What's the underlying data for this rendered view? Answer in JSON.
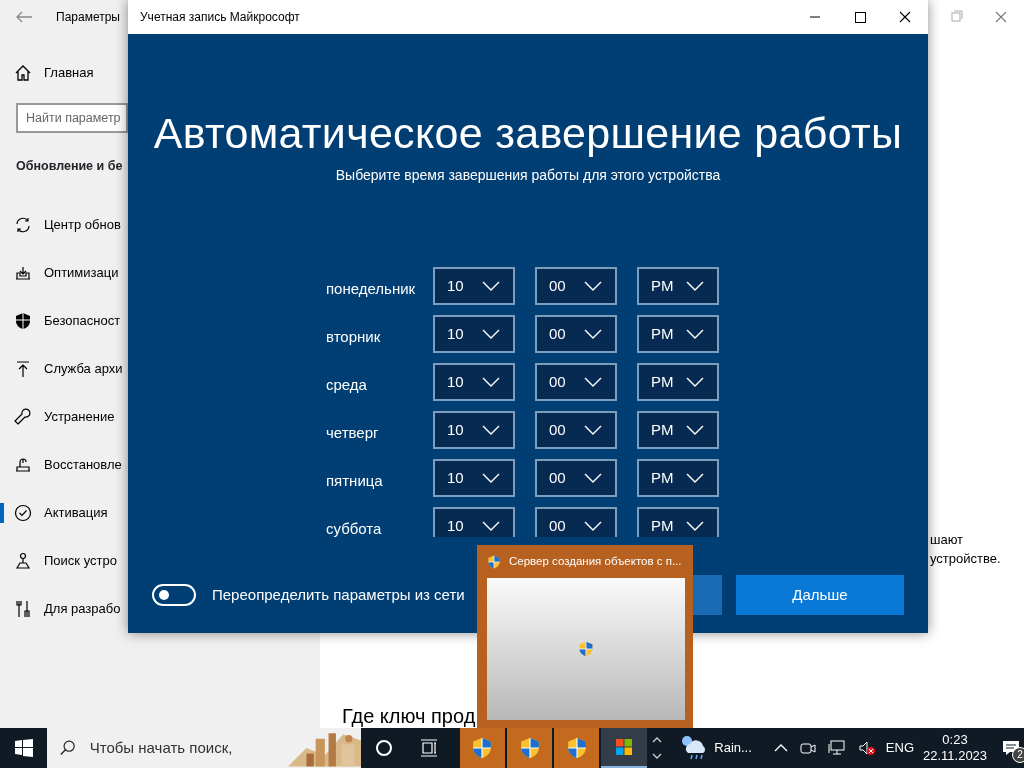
{
  "settings_window": {
    "title": "Параметры",
    "sidebar": {
      "home": "Главная",
      "search_placeholder": "Найти параметр",
      "section_title": "Обновление и бе",
      "items": [
        {
          "label": "Центр обнов",
          "selected": false
        },
        {
          "label": "Оптимизаци",
          "selected": false
        },
        {
          "label": "Безопасност",
          "selected": false
        },
        {
          "label": "Служба архи",
          "selected": false
        },
        {
          "label": "Устранение",
          "selected": false
        },
        {
          "label": "Восстановле",
          "selected": false
        },
        {
          "label": "Активация",
          "selected": true
        },
        {
          "label": "Поиск устро",
          "selected": false
        },
        {
          "label": "Для разрабо",
          "selected": false
        }
      ]
    },
    "content": {
      "text_lines": [
        "шают",
        "устройстве."
      ],
      "heading": "Где ключ прод"
    }
  },
  "dialog": {
    "title": "Учетная запись Майкрософт",
    "heading": "Автоматическое завершение работы",
    "subtitle": "Выберите время завершения работы для этого устройства",
    "schedule": [
      {
        "day": "понедельник",
        "hour": "10",
        "minute": "00",
        "period": "PM"
      },
      {
        "day": "вторник",
        "hour": "10",
        "minute": "00",
        "period": "PM"
      },
      {
        "day": "среда",
        "hour": "10",
        "minute": "00",
        "period": "PM"
      },
      {
        "day": "четверг",
        "hour": "10",
        "minute": "00",
        "period": "PM"
      },
      {
        "day": "пятница",
        "hour": "10",
        "minute": "00",
        "period": "PM"
      },
      {
        "day": "суббота",
        "hour": "10",
        "minute": "00",
        "period": "PM"
      }
    ],
    "override_toggle": {
      "label": "Переопределить параметры из сети",
      "on": false
    },
    "buttons": [
      {
        "kind": "secondary"
      },
      {
        "kind": "primary",
        "label": "Дальше"
      }
    ]
  },
  "popup": {
    "title": "Сервер создания объектов с п..."
  },
  "taskbar": {
    "search_placeholder": "Чтобы начать поиск,",
    "apps": [
      {
        "kind": "shield",
        "flashing": true
      },
      {
        "kind": "shield",
        "flashing": true
      },
      {
        "kind": "shield",
        "flashing": true
      },
      {
        "kind": "store",
        "flashing": false
      }
    ],
    "weather": "Rain...",
    "language": "ENG",
    "time": "0:23",
    "date": "22.11.2023",
    "notifications": "2"
  }
}
